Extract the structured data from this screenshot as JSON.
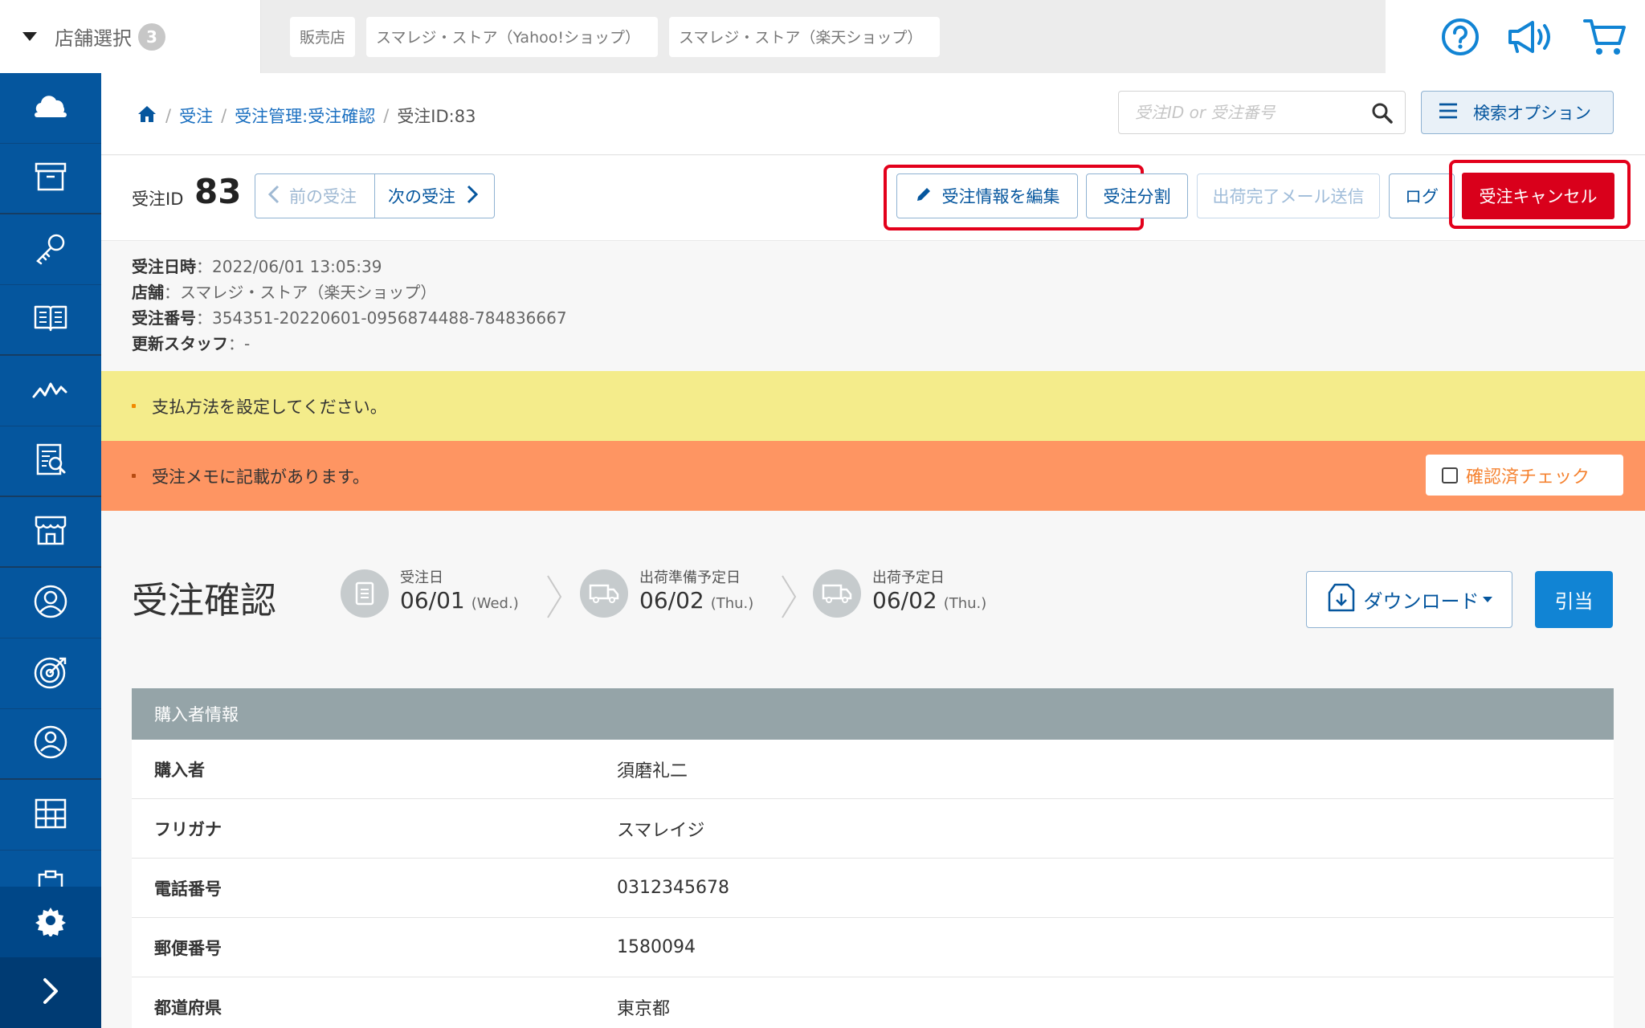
{
  "topbar": {
    "store_select_label": "店舗選択",
    "store_count": "3",
    "store_tabs": [
      "販売店",
      "スマレジ・ストア（Yahoo!ショップ）",
      "スマレジ・ストア（楽天ショップ）"
    ],
    "icons": [
      "help-circle-icon",
      "megaphone-icon",
      "cart-icon"
    ]
  },
  "sidebar": {
    "items": [
      "cloud-icon",
      "archive-box-icon",
      "key-icon",
      "book-icon",
      "chart-line-icon",
      "report-search-icon",
      "store-icon",
      "user-circle-icon",
      "target-icon",
      "member-icon",
      "grid-icon",
      "clipboard-icon"
    ],
    "bottom": [
      "gear-icon",
      "chevron-right-icon"
    ]
  },
  "breadcrumb": {
    "items": [
      "受注",
      "受注管理:受注確認"
    ],
    "current": "受注ID:83",
    "sep": "/"
  },
  "search": {
    "placeholder": "受注ID or 受注番号",
    "options_label": "検索オプション"
  },
  "order": {
    "id_label": "受注ID",
    "id_value": "83",
    "prev_label": "前の受注",
    "next_label": "次の受注",
    "edit_label": "受注情報を編集",
    "split_label": "受注分割",
    "ship_mail_label": "出荷完了メール送信",
    "log_label": "ログ",
    "cancel_label": "受注キャンセル"
  },
  "meta": {
    "date_key": "受注日時",
    "date_value": "2022/06/01 13:05:39",
    "store_key": "店舗",
    "store_value": "スマレジ・ストア（楽天ショップ）",
    "number_key": "受注番号",
    "number_value": "354351-20220601-0956874488-784836667",
    "staff_key": "更新スタッフ",
    "staff_value": "-",
    "colon": "："
  },
  "notices": {
    "payment": "支払方法を設定してください。",
    "memo": "受注メモに記載があります。",
    "confirm_check": "確認済チェック"
  },
  "confirm": {
    "title": "受注確認",
    "steps": [
      {
        "label": "受注日",
        "date": "06/01",
        "day": "(Wed.)"
      },
      {
        "label": "出荷準備予定日",
        "date": "06/02",
        "day": "(Thu.)"
      },
      {
        "label": "出荷予定日",
        "date": "06/02",
        "day": "(Thu.)"
      }
    ],
    "download_label": "ダウンロード",
    "allocate_label": "引当"
  },
  "buyer": {
    "header": "購入者情報",
    "rows": [
      {
        "key": "購入者",
        "value": "須磨礼二"
      },
      {
        "key": "フリガナ",
        "value": "スマレイジ"
      },
      {
        "key": "電話番号",
        "value": "0312345678"
      },
      {
        "key": "郵便番号",
        "value": "1580094"
      },
      {
        "key": "都道府県",
        "value": "東京都"
      }
    ]
  },
  "colors": {
    "sidebar": "#05569e",
    "accent": "#1184d4",
    "cancel": "#d9001b",
    "notice_yellow": "#f4ec8b",
    "notice_orange": "#fe9562",
    "highlight_frame": "#e3001b"
  }
}
